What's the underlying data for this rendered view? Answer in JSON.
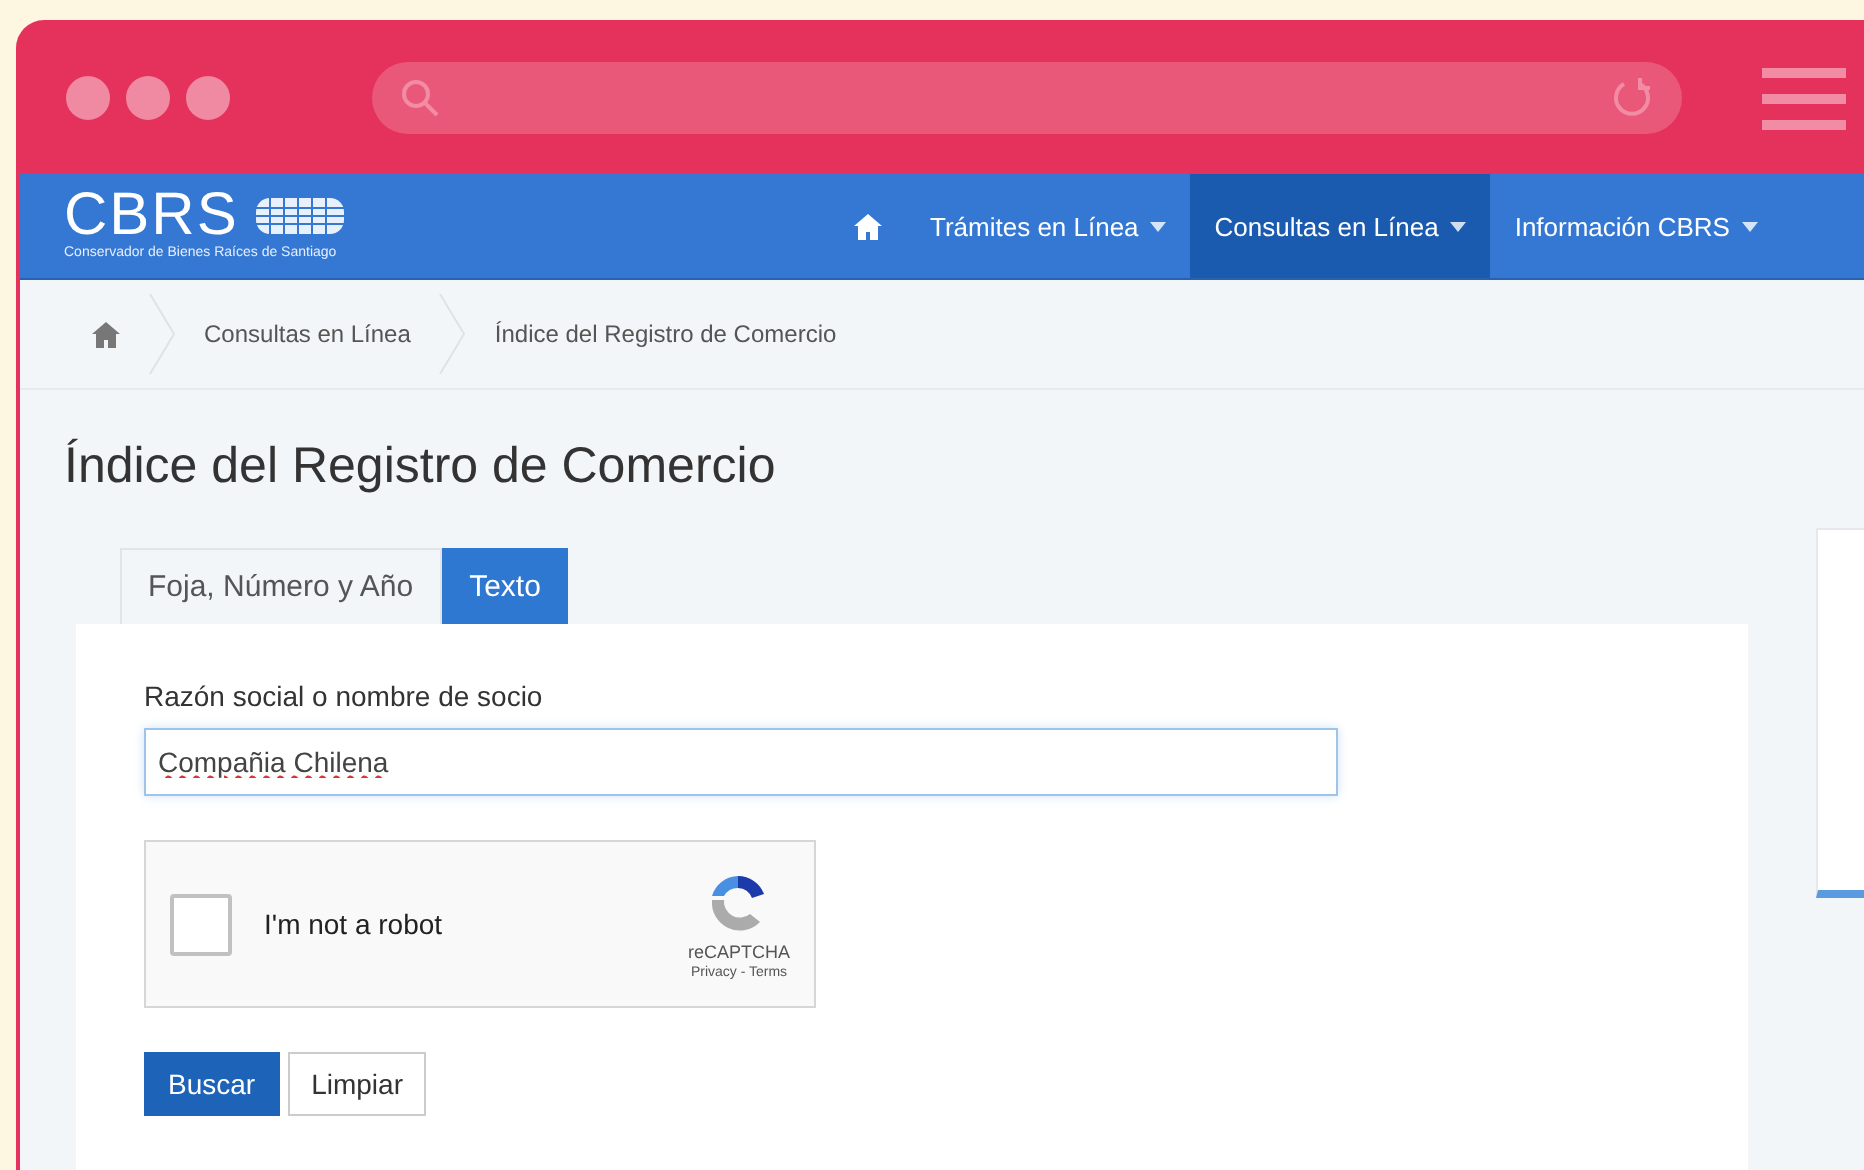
{
  "logo": {
    "name": "CBRS",
    "subtitle": "Conservador de Bienes Raíces de Santiago"
  },
  "nav": [
    {
      "kind": "home",
      "selected": false
    },
    {
      "kind": "menu",
      "label": "Trámites en Línea",
      "selected": false
    },
    {
      "kind": "menu",
      "label": "Consultas en Línea",
      "selected": true
    },
    {
      "kind": "menu",
      "label": "Información CBRS",
      "selected": false
    }
  ],
  "breadcrumb": [
    "Consultas en Línea",
    "Índice del Registro de Comercio"
  ],
  "page_title": "Índice del Registro de Comercio",
  "tabs": [
    {
      "label": "Foja, Número y Año",
      "selected": false
    },
    {
      "label": "Texto",
      "selected": true
    }
  ],
  "field": {
    "label": "Razón social o nombre de socio",
    "value": "Compañia Chilena"
  },
  "captcha": {
    "label": "I'm not a robot",
    "checked": false,
    "brand": "reCAPTCHA",
    "links": "Privacy - Terms"
  },
  "buttons": [
    {
      "label": "Buscar",
      "kind": "primary"
    },
    {
      "label": "Limpiar",
      "kind": "default"
    }
  ]
}
